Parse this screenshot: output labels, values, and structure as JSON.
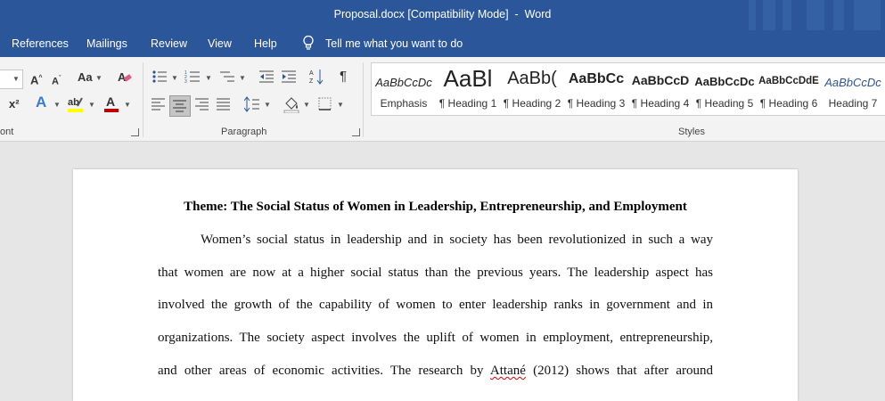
{
  "window": {
    "title_file": "Proposal.docx [Compatibility Mode]",
    "title_sep": "  -  ",
    "title_app": "Word"
  },
  "menu": {
    "tabs": [
      "References",
      "Mailings",
      "Review",
      "View",
      "Help"
    ],
    "tell_me": "Tell me what you want to do"
  },
  "ribbon": {
    "groups": {
      "font": "ont",
      "paragraph": "Paragraph",
      "styles": "Styles"
    },
    "styles": [
      {
        "preview": "AaBbCcDc",
        "label": "Emphasis"
      },
      {
        "preview": "AaBl",
        "label": "¶ Heading 1"
      },
      {
        "preview": "AaBb(",
        "label": "¶ Heading 2"
      },
      {
        "preview": "AaBbCc",
        "label": "¶ Heading 3"
      },
      {
        "preview": "AaBbCcD",
        "label": "¶ Heading 4"
      },
      {
        "preview": "AaBbCcDc",
        "label": "¶ Heading 5"
      },
      {
        "preview": "AaBbCcDdE",
        "label": "¶ Heading 6"
      },
      {
        "preview": "AaBbCcDc",
        "label": "Heading 7"
      }
    ],
    "font_color": "#c00000",
    "highlight_color": "#ffff00"
  },
  "document": {
    "title": "Theme: The Social Status of Women in Leadership, Entrepreneurship, and Employment",
    "lines": [
      "Women’s social status in leadership and in society has been revolutionized in such a way",
      "that women are now at a higher social status than the previous years. The leadership aspect has",
      "involved the growth of the capability of women to enter leadership ranks in government and in",
      "organizations. The society aspect involves the uplift of women in employment, entrepreneurship,"
    ],
    "last_line_pre": "and other areas of economic activities. The research by",
    "last_line_citation": "Attané",
    "last_line_post": "(2012) shows that after around"
  }
}
